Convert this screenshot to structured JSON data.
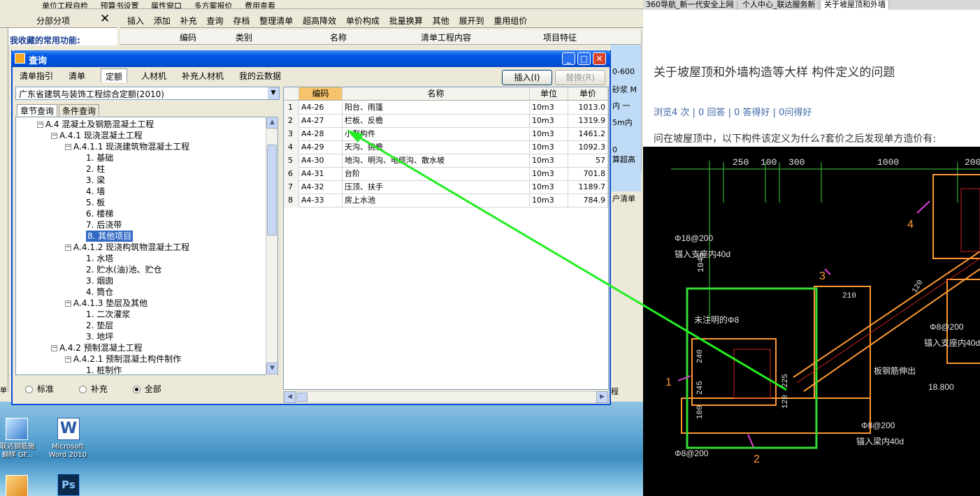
{
  "app_toolbar_top": [
    "单位工程自检",
    "预算书设置",
    "属性窗口",
    "多方案报价",
    "费用查看"
  ],
  "left_panel": {
    "title": "分部分项",
    "favorites_label": "我收藏的常用功能:",
    "side_label": "单",
    "status_label": "早"
  },
  "toolbar2": [
    "插入",
    "添加",
    "补充",
    "查询",
    "存档",
    "整理清单",
    "超高降效",
    "单价构成",
    "批量换算",
    "其他",
    "展开到",
    "重用组价"
  ],
  "table_header": [
    "编码",
    "类别",
    "名称",
    "清单工程内容",
    "项目特征"
  ],
  "bg_right_col": [
    "0-600",
    "砂浆 M",
    "内 一",
    "5m内",
    "0",
    "算超高",
    "户清单",
    "程"
  ],
  "dialog": {
    "title": "查询",
    "tabs": [
      "清单指引",
      "清单",
      "定额",
      "人材机",
      "补充人材机",
      "我的云数据"
    ],
    "selected_tab": "定额",
    "insert_button": "插入(I)",
    "replace_button": "替换(R)",
    "quota_library": "广东省建筑与装饰工程综合定额(2010)",
    "search_tabs": [
      "章节查询",
      "条件查询"
    ],
    "tree": [
      {
        "label": "A.4 混凝土及钢筋混凝土工程",
        "level": 0,
        "box": "−"
      },
      {
        "label": "A.4.1 现浇混凝土工程",
        "level": 1,
        "box": "−"
      },
      {
        "label": "A.4.1.1 现浇建筑物混凝土工程",
        "level": 2,
        "box": "−"
      },
      {
        "label": "1. 基础",
        "level": 3
      },
      {
        "label": "2. 柱",
        "level": 3
      },
      {
        "label": "3. 梁",
        "level": 3
      },
      {
        "label": "4. 墙",
        "level": 3
      },
      {
        "label": "5. 板",
        "level": 3
      },
      {
        "label": "6. 楼梯",
        "level": 3
      },
      {
        "label": "7. 后浇带",
        "level": 3
      },
      {
        "label": "8. 其他项目",
        "level": 3,
        "selected": true
      },
      {
        "label": "A.4.1.2 现浇构筑物混凝土工程",
        "level": 2,
        "box": "−"
      },
      {
        "label": "1. 水塔",
        "level": 3
      },
      {
        "label": "2. 贮水(油)池、贮仓",
        "level": 3
      },
      {
        "label": "3. 烟囱",
        "level": 3
      },
      {
        "label": "4. 筒仓",
        "level": 3
      },
      {
        "label": "A.4.1.3 垫层及其他",
        "level": 2,
        "box": "−"
      },
      {
        "label": "1. 二次灌浆",
        "level": 3
      },
      {
        "label": "2. 垫层",
        "level": 3
      },
      {
        "label": "3. 地坪",
        "level": 3
      },
      {
        "label": "A.4.2 预制混凝土工程",
        "level": 1,
        "box": "−"
      },
      {
        "label": "A.4.2.1 预制混凝土构件制作",
        "level": 2,
        "box": "−"
      },
      {
        "label": "1. 桩制作",
        "level": 3
      }
    ],
    "filter": {
      "options": [
        "标准",
        "补充",
        "全部"
      ],
      "selected": "全部"
    },
    "grid_headers": [
      "编码",
      "名称",
      "单位",
      "单价"
    ],
    "grid_rows": [
      {
        "n": "1",
        "code": "A4-26",
        "name": "阳台、雨篷",
        "unit": "10m3",
        "price": "1013.0"
      },
      {
        "n": "2",
        "code": "A4-27",
        "name": "栏板、反檐",
        "unit": "10m3",
        "price": "1319.9"
      },
      {
        "n": "3",
        "code": "A4-28",
        "name": "小型构件",
        "unit": "10m3",
        "price": "1461.2"
      },
      {
        "n": "4",
        "code": "A4-29",
        "name": "天沟、挑檐",
        "unit": "10m3",
        "price": "1092.3"
      },
      {
        "n": "5",
        "code": "A4-30",
        "name": "地沟、明沟、电缆沟、散水坡",
        "unit": "10m3",
        "price": "57"
      },
      {
        "n": "6",
        "code": "A4-31",
        "name": "台阶",
        "unit": "10m3",
        "price": "701.8"
      },
      {
        "n": "7",
        "code": "A4-32",
        "name": "压顶、扶手",
        "unit": "10m3",
        "price": "1189.7"
      },
      {
        "n": "8",
        "code": "A4-33",
        "name": "房上水池",
        "unit": "10m3",
        "price": "784.9"
      }
    ]
  },
  "desktop_icons": [
    {
      "label1": "联达钢筋施",
      "label2": "翻样 GF..."
    },
    {
      "label1": "Microsoft",
      "label2": "Word 2010"
    },
    {
      "label1": "",
      "label2": ""
    },
    {
      "label1": "Ps",
      "label2": ""
    }
  ],
  "browser": {
    "tabs": [
      "360导航_新一代安全上网",
      "个人中心_联达服务新",
      "关于坡屋顶和外墙"
    ],
    "title": "关于坡屋顶和外墙构造等大样 构件定义的问题",
    "stats": "浏览4 次 | 0 回答 | 0 答得好 | 0问得好",
    "question": "问在坡屋顶中，以下构件该定义为什么?套价之后发现单方造价有:"
  },
  "cad": {
    "dims": [
      "250",
      "100",
      "300",
      "1000",
      "200",
      "1045",
      "240",
      "210",
      "245",
      "100",
      "120",
      "225",
      "120",
      "18.800"
    ],
    "labels": [
      "Φ18@200",
      "锚入支座内40d",
      "Φ8@200",
      "锚入支座内40d",
      "未注明的Φ8",
      "板钢筋伸出",
      "Φ8@200",
      "锚入梁内40d",
      "Φ8@200"
    ],
    "markers": [
      "1",
      "2",
      "3",
      "4"
    ],
    "marker_color": "#ff9933"
  }
}
